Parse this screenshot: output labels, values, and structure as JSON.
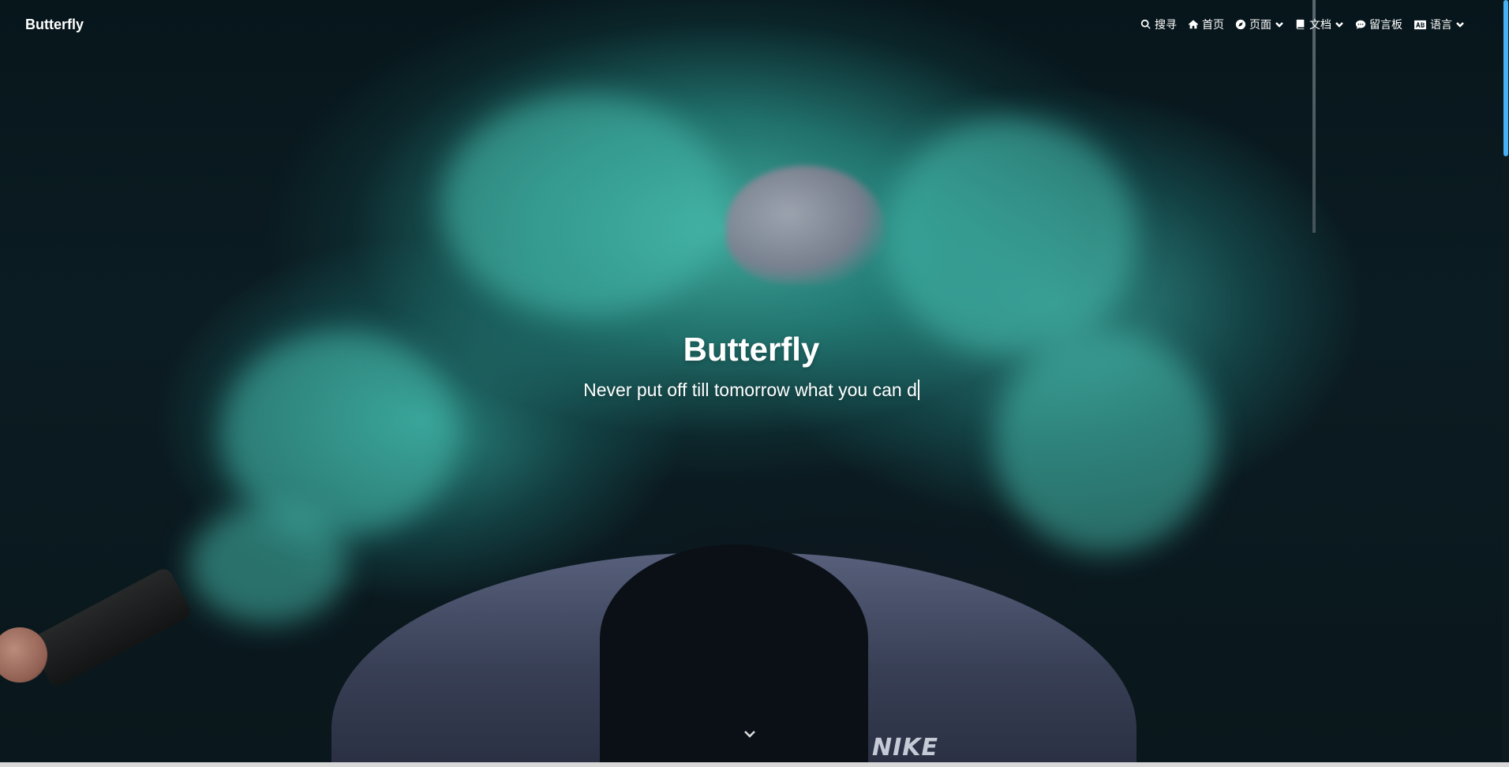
{
  "navbar": {
    "brand": "Butterfly",
    "menu": [
      {
        "icon": "search-icon",
        "label": "搜寻",
        "dropdown": false
      },
      {
        "icon": "home-icon",
        "label": "首页",
        "dropdown": false
      },
      {
        "icon": "compass-icon",
        "label": "页面",
        "dropdown": true
      },
      {
        "icon": "book-icon",
        "label": "文档",
        "dropdown": true
      },
      {
        "icon": "comment-icon",
        "label": "留言板",
        "dropdown": false
      },
      {
        "icon": "language-icon",
        "label": "语言",
        "dropdown": true
      }
    ]
  },
  "hero": {
    "title": "Butterfly",
    "subtitle": "Never put off till tomorrow what you can d"
  },
  "theme": {
    "scrollbar_color": "#49b1f5",
    "text_color": "#ffffff"
  }
}
